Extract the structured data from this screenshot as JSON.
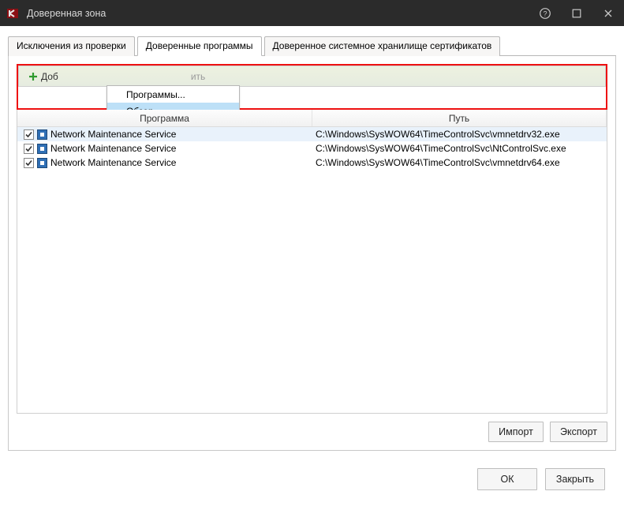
{
  "title": "Доверенная зона",
  "tabs": {
    "exclusions": "Исключения из проверки",
    "trusted": "Доверенные программы",
    "certstore": "Доверенное системное хранилище сертификатов"
  },
  "toolbar": {
    "add": "Доб",
    "delete_trunc": "ить"
  },
  "dropdown": {
    "programs": "Программы...",
    "browse": "Обзор..."
  },
  "grid": {
    "col_program": "Программа",
    "col_path": "Путь",
    "rows": [
      {
        "name": "Network Maintenance Service",
        "path": "C:\\Windows\\SysWOW64\\TimeControlSvc\\vmnetdrv32.exe"
      },
      {
        "name": "Network Maintenance Service",
        "path": "C:\\Windows\\SysWOW64\\TimeControlSvc\\NtControlSvc.exe"
      },
      {
        "name": "Network Maintenance Service",
        "path": "C:\\Windows\\SysWOW64\\TimeControlSvc\\vmnetdrv64.exe"
      }
    ]
  },
  "panel_buttons": {
    "import": "Импорт",
    "export": "Экспорт"
  },
  "dialog_buttons": {
    "ok": "ОК",
    "close": "Закрыть"
  }
}
